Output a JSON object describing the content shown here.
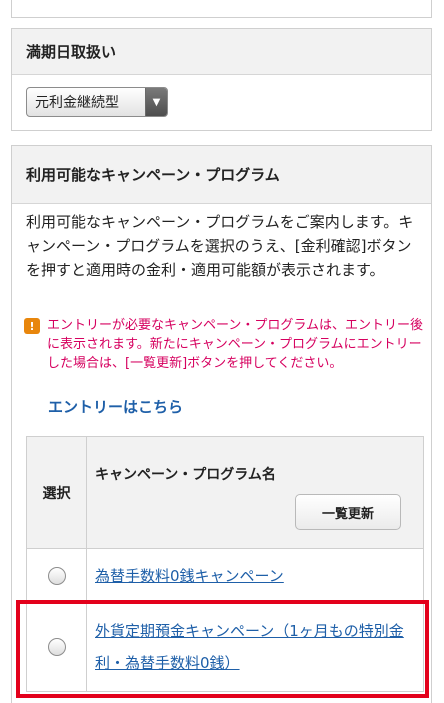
{
  "maturity": {
    "title": "満期日取扱い",
    "select_value": "元利金継続型"
  },
  "campaign": {
    "title": "利用可能なキャンペーン・プログラム",
    "intro": "利用可能なキャンペーン・プログラムをご案内します。キャンペーン・プログラムを選択のうえ、[金利確認]ボタンを押すと適用時の金利・適用可能額が表示されます。",
    "notice_icon": "!",
    "notice": "エントリーが必要なキャンペーン・プログラムは、エントリー後に表示されます。新たにキャンペーン・プログラムにエントリーした場合は、[一覧更新]ボタンを押してください。",
    "entry_link": "エントリーはこちら",
    "table": {
      "col_select": "選択",
      "col_name": "キャンペーン・プログラム名",
      "refresh_label": "一覧更新",
      "rows": [
        {
          "name": "為替手数料0銭キャンペーン"
        },
        {
          "name": "外貨定期預金キャンペーン（1ヶ月もの特別金利・為替手数料0銭）"
        }
      ]
    }
  },
  "colors": {
    "link": "#1e5fa8",
    "notice_text": "#d6005f",
    "notice_icon": "#e8860c",
    "highlight_border": "#e3001b"
  },
  "icons": {
    "notice": "exclamation-icon",
    "select_arrow": "triangle-down-icon"
  }
}
